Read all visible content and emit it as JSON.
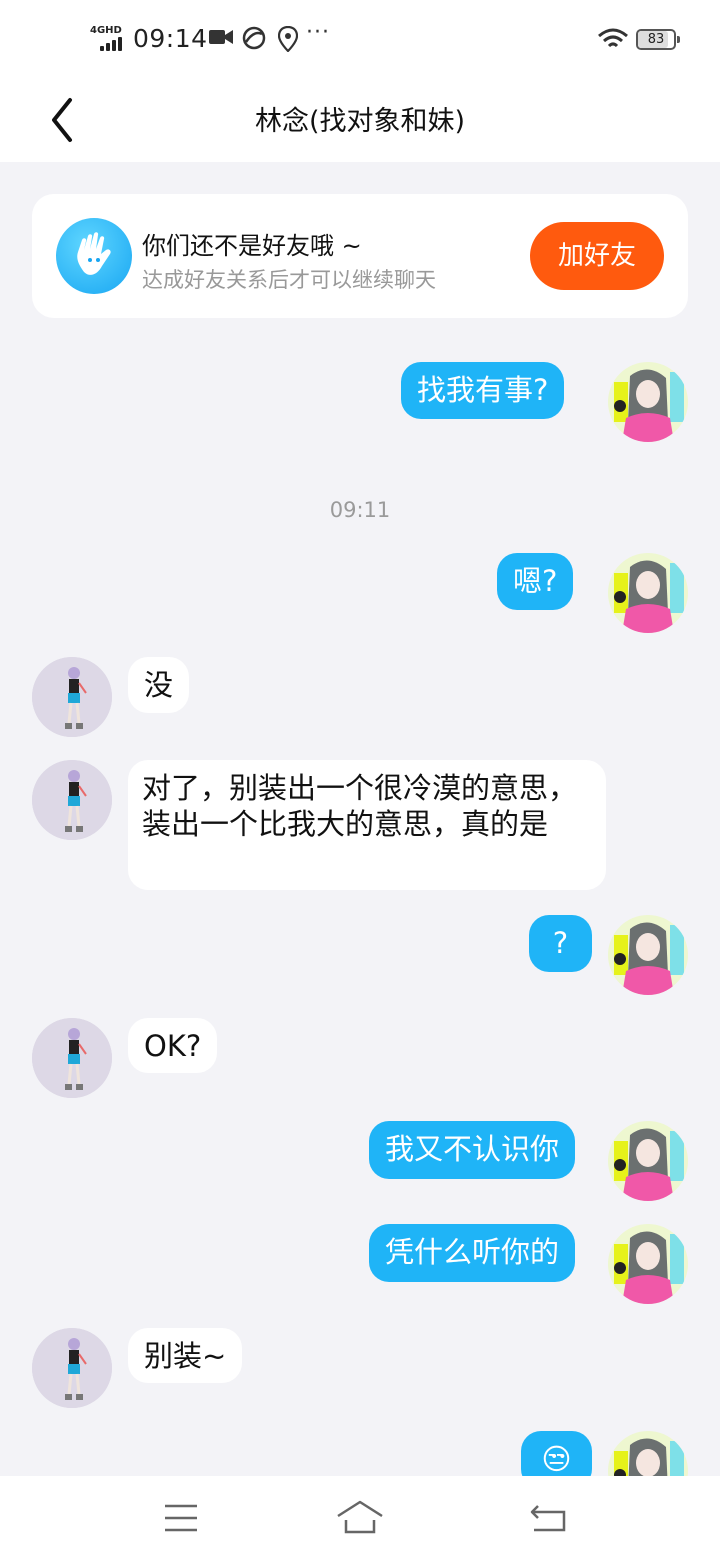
{
  "status_bar": {
    "network": "4GHD",
    "time": "09:14",
    "more": "···",
    "battery": "83",
    "battery_level": 0.83
  },
  "header": {
    "back_icon": "chevron-left-icon",
    "title": "林念(找对象和妹)"
  },
  "friend_card": {
    "title": "你们还不是好友哦 ~",
    "subtitle": "达成好友关系后才可以继续聊天",
    "button": "加好友"
  },
  "timestamp": "09:11",
  "messages": [
    {
      "from": "me",
      "text": "找我有事?"
    },
    {
      "from": "me",
      "text": "嗯?"
    },
    {
      "from": "them",
      "text": "没"
    },
    {
      "from": "them",
      "text": "对了，别装出一个很冷漠的意思，装出一个比我大的意思，真的是"
    },
    {
      "from": "me",
      "text": "?"
    },
    {
      "from": "them",
      "text": "OK?"
    },
    {
      "from": "me",
      "text": "我又不认识你"
    },
    {
      "from": "me",
      "text": "凭什么听你的"
    },
    {
      "from": "them",
      "text": "别装~"
    },
    {
      "from": "me",
      "text": "😒"
    }
  ],
  "colors": {
    "my_bubble": "#1fb4f7",
    "their_bubble": "#ffffff",
    "add_friend_button": "#ff5a0e",
    "background": "#f3f3f7"
  },
  "bottom_nav": {
    "menu_icon": "menu-icon",
    "home_icon": "home-icon",
    "back_icon": "back-arrow-icon"
  }
}
